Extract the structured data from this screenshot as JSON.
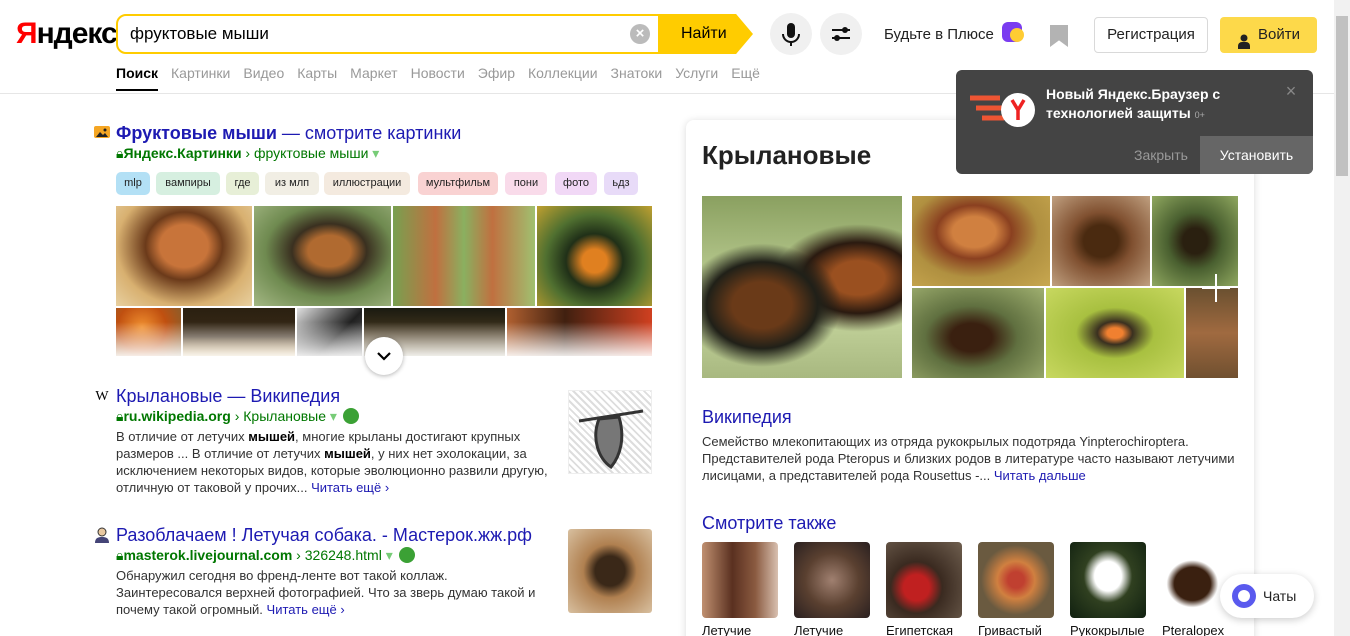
{
  "header": {
    "logo": "Яндекс",
    "logo_first": "Я",
    "logo_rest": "ндекс",
    "search_value": "фруктовые мыши",
    "find_label": "Найти",
    "plus_label": "Будьте в Плюсе",
    "register_label": "Регистрация",
    "login_label": "Войти"
  },
  "tabs": [
    "Поиск",
    "Картинки",
    "Видео",
    "Карты",
    "Маркет",
    "Новости",
    "Эфир",
    "Коллекции",
    "Знатоки",
    "Услуги",
    "Ещё"
  ],
  "images_result": {
    "title_bold": "Фруктовые мыши",
    "title_rest": " — смотрите картинки",
    "source": "Яндекс.Картинки",
    "path": "фруктовые мыши",
    "chips": [
      {
        "label": "mlp",
        "color": "#b3e0f5"
      },
      {
        "label": "вампиры",
        "color": "#d6efe0"
      },
      {
        "label": "где",
        "color": "#e7efd7"
      },
      {
        "label": "из млп",
        "color": "#f1eee4"
      },
      {
        "label": "иллюстрации",
        "color": "#f4eadf"
      },
      {
        "label": "мультфильм",
        "color": "#f9d2d2"
      },
      {
        "label": "пони",
        "color": "#f9dbea"
      },
      {
        "label": "фото",
        "color": "#f1d8f6"
      },
      {
        "label": "ьдз",
        "color": "#e8dbf8"
      }
    ]
  },
  "result2": {
    "icon": "W",
    "title": "Крылановые — Википедия",
    "domain": "ru.wikipedia.org",
    "path": "Крылановые",
    "text_a": "В отличие от летучих ",
    "text_b": "мышей",
    "text_c": ", многие крыланы достигают крупных размеров ... В отличие от летучих ",
    "text_d": "мышей",
    "text_e": ", у них нет эхолокации, за исключением некоторых видов, которые эволюционно развили другую, отличную от таковой у прочих... ",
    "more": "Читать ещё"
  },
  "result3": {
    "title": "Разоблачаем ! Летучая собака. - Мастерок.жж.рф",
    "domain": "masterok.livejournal.com",
    "path": "326248.html",
    "text": "Обнаружил сегодня во френд-ленте вот такой коллаж. Заинтересовался верхней фотографией. Что за зверь думаю такой и почему такой огромный. ",
    "more": "Читать ещё"
  },
  "panel": {
    "title": "Крылановые",
    "wiki_link": "Википедия",
    "wiki_text": "Семейство млекопитающих из отряда рукокрылых подотряда Yinpterochiroptera. Представителей рода Pteropus и близких родов в литературе часто называют летучими лисицами, а представителей рода Rousettus -... ",
    "wiki_more": "Читать дальше",
    "see_also": "Смотрите также",
    "see_also_items": [
      "Летучие",
      "Летучие",
      "Египетская",
      "Гривастый",
      "Рукокрылые",
      "Pteralopex"
    ]
  },
  "toast": {
    "text": "Новый Яндекс.Браузер с технологией защиты",
    "badge": "0+",
    "close_label": "Закрыть",
    "install_label": "Установить"
  },
  "chats_label": "Чаты",
  "colors": {
    "accent": "#ffcc00",
    "link": "#1d1ab2",
    "url": "#007700"
  }
}
